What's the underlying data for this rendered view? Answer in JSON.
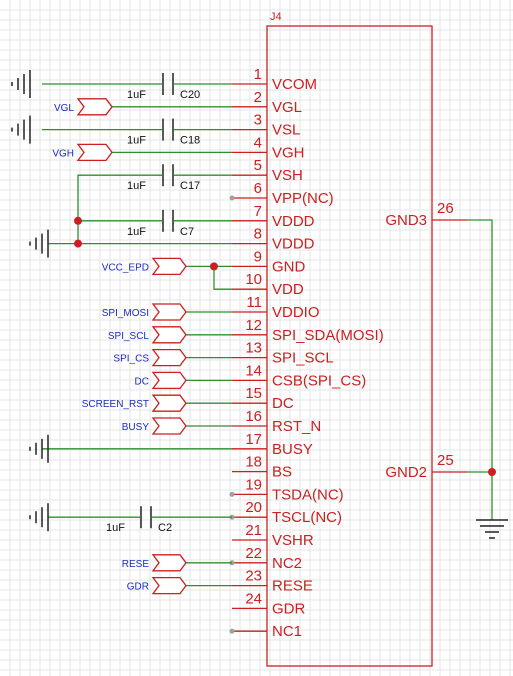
{
  "component": {
    "ref": "J4"
  },
  "left_pins": [
    {
      "num": "1",
      "name": "VCOM"
    },
    {
      "num": "2",
      "name": "VGL"
    },
    {
      "num": "3",
      "name": "VSL"
    },
    {
      "num": "4",
      "name": "VGH"
    },
    {
      "num": "5",
      "name": "VSH"
    },
    {
      "num": "6",
      "name": "VPP(NC)"
    },
    {
      "num": "7",
      "name": "VDDD"
    },
    {
      "num": "8",
      "name": "VDDD"
    },
    {
      "num": "9",
      "name": "GND"
    },
    {
      "num": "10",
      "name": "VDD"
    },
    {
      "num": "11",
      "name": "VDDIO"
    },
    {
      "num": "12",
      "name": "SPI_SDA(MOSI)"
    },
    {
      "num": "13",
      "name": "SPI_SCL"
    },
    {
      "num": "14",
      "name": "CSB(SPI_CS)"
    },
    {
      "num": "15",
      "name": "DC"
    },
    {
      "num": "16",
      "name": "RST_N"
    },
    {
      "num": "17",
      "name": "BUSY"
    },
    {
      "num": "18",
      "name": "BS"
    },
    {
      "num": "19",
      "name": "TSDA(NC)"
    },
    {
      "num": "20",
      "name": "TSCL(NC)"
    },
    {
      "num": "21",
      "name": "VSHR"
    },
    {
      "num": "22",
      "name": "NC2"
    },
    {
      "num": "23",
      "name": "RESE"
    },
    {
      "num": "24",
      "name": "GDR"
    },
    {
      "num": "",
      "name": "NC1"
    }
  ],
  "right_pins": [
    {
      "num": "26",
      "name": "GND3"
    },
    {
      "num": "25",
      "name": "GND2"
    }
  ],
  "net_flags": [
    "VGL",
    "VGH",
    "VCC_EPD",
    "SPI_MOSI",
    "SPI_SCL",
    "SPI_CS",
    "DC",
    "SCREEN_RST",
    "BUSY",
    "RESE",
    "GDR"
  ],
  "capacitors": [
    {
      "ref": "C20",
      "value": "1uF"
    },
    {
      "ref": "C18",
      "value": "1uF"
    },
    {
      "ref": "C17",
      "value": "1uF"
    },
    {
      "ref": "C7",
      "value": "1uF"
    },
    {
      "ref": "C2",
      "value": "1uF"
    }
  ],
  "colors": {
    "component": "#cc1f1f",
    "wire": "#2f8f2f",
    "net_label": "#1a2bbf",
    "grid": "#e6e6e6"
  }
}
